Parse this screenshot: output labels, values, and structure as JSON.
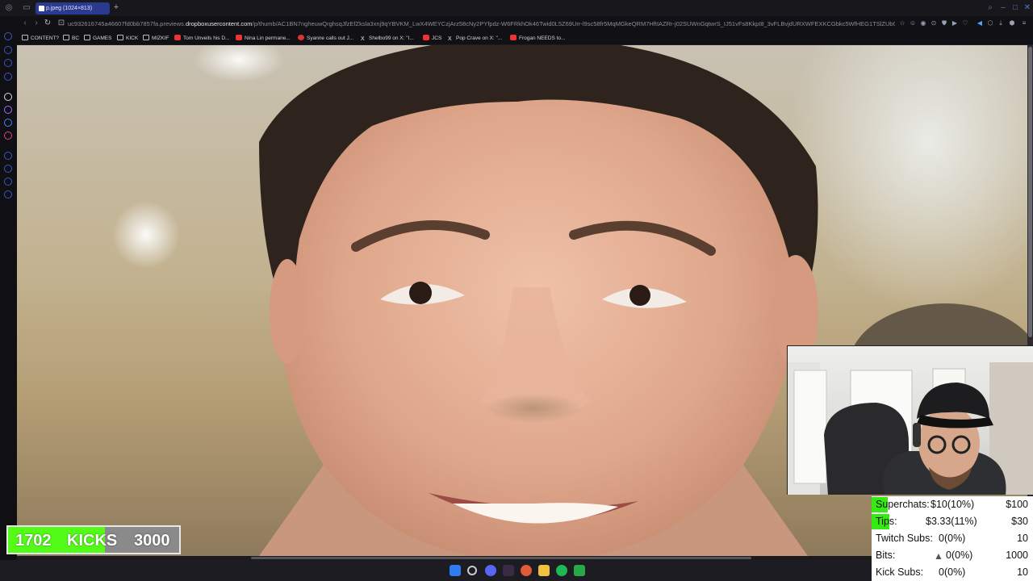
{
  "browser": {
    "tab_title": "p.jpeg (1024×813)",
    "url_prefix": "uc932616745a46607fd0bb7857fa.previews.",
    "url_domain": "dropboxusercontent.com",
    "url_suffix": "/p/thumb/AC1BN7ngheuwQrghsqJfzEfZksla3xnj9qYBVKM_LwX4WEYCzjArz58cNy2PYfpdz-W6FRkhOk46Twid0L5Z69Urr-l9sc58fr5MqMGkeQRM7HftIAZRr-j02SUWnGqtwrS_IJ51vFs8KkpI8_3vFLBvjdURXWFEXKCGbkc5WfHEG1TSlZUbQSD5JQHciwaX2jM",
    "bookmarks": [
      {
        "label": "CONTENT?",
        "icon": "folder"
      },
      {
        "label": "BC",
        "icon": "folder"
      },
      {
        "label": "GAMES",
        "icon": "folder"
      },
      {
        "label": "KICK",
        "icon": "folder"
      },
      {
        "label": "MIZKIF",
        "icon": "folder"
      },
      {
        "label": "Tom Unveils his D...",
        "icon": "youtube"
      },
      {
        "label": "Nina Lin permane...",
        "icon": "youtube"
      },
      {
        "label": "Syanne calls out J...",
        "icon": "reddit"
      },
      {
        "label": "Shelbo99 on X: \"I...",
        "icon": "x"
      },
      {
        "label": "JCS",
        "icon": "youtube"
      },
      {
        "label": "Pop Crave on X: \"...",
        "icon": "x"
      },
      {
        "label": "Frogan NEEDS to...",
        "icon": "youtube"
      }
    ]
  },
  "kicks_goal": {
    "current": "1702",
    "label": "KICKS",
    "goal": "3000",
    "progress": 0.567,
    "color": "#53fc18"
  },
  "stats": {
    "rows": [
      {
        "label": "Superchats:",
        "value": "$10(10%)",
        "goal": "$100",
        "progress": 0.1
      },
      {
        "label": "Tips:",
        "value": "$3.33(11%)",
        "goal": "$30",
        "progress": 0.11
      },
      {
        "label": "Twitch Subs:",
        "value": "0(0%)",
        "goal": "10",
        "progress": 0
      },
      {
        "label": "Bits:",
        "value": "0(0%)",
        "goal": "1000",
        "progress": 0,
        "icon": "bits-triangle-icon"
      },
      {
        "label": "Kick Subs:",
        "value": "0(0%)",
        "goal": "10",
        "progress": 0
      }
    ],
    "bar_color": "#34ea12"
  },
  "colors": {
    "tab_active": "#2a3a8f",
    "accent": "#3b57c7"
  }
}
